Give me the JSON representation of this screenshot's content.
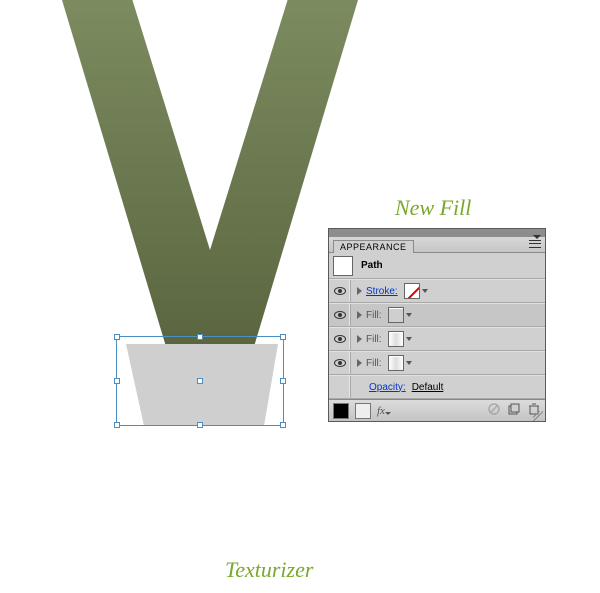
{
  "labels": {
    "new_fill": "New Fill",
    "texturizer": "Texturizer"
  },
  "panel": {
    "tab": "APPEARANCE",
    "target": "Path",
    "rows": [
      {
        "kind": "attr",
        "label": "Stroke:",
        "link": true,
        "swatch": "none"
      },
      {
        "kind": "attr",
        "label": "Fill:",
        "link": false,
        "swatch": "grey"
      },
      {
        "kind": "attr",
        "label": "Fill:",
        "link": false,
        "swatch": "gradient"
      },
      {
        "kind": "attr",
        "label": "Fill:",
        "link": false,
        "swatch": "gradient"
      },
      {
        "kind": "opacity",
        "label": "Opacity:",
        "value": "Default"
      }
    ],
    "footer_icons": [
      "solid-swatch",
      "empty-swatch",
      "fx",
      "clear",
      "dup",
      "trash"
    ]
  },
  "colors": {
    "accent_green": "#7aa82c",
    "v_top": "#808f64",
    "v_bottom": "#545f39",
    "trap_fill": "#cfcfcf",
    "selection": "#4a8ec2",
    "panel_chrome": "#c2c2c2"
  },
  "artwork": {
    "shape": "letter V with trapezoid overlay near base",
    "trapezoid_selected": true
  }
}
